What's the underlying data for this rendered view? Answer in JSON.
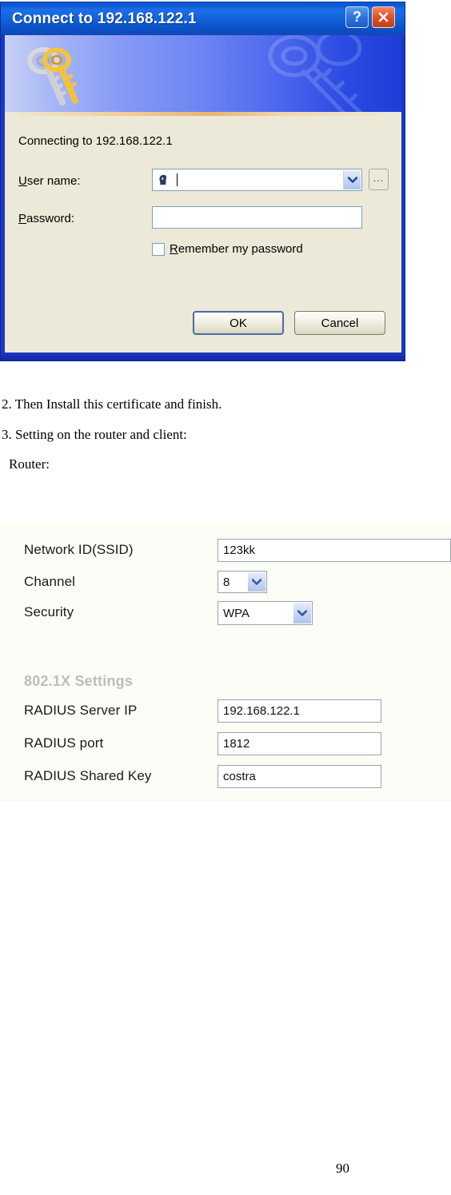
{
  "dialog": {
    "title": "Connect to 192.168.122.1",
    "help_button": "?",
    "close_button": "×",
    "connecting_text": "Connecting to 192.168.122.1",
    "username_label": "User name:",
    "username_value": "",
    "password_label": "Password:",
    "password_value": "",
    "browse_button": "...",
    "remember_label": "Remember my password",
    "remember_checked": false,
    "ok_button": "OK",
    "cancel_button": "Cancel",
    "colors": {
      "titlebar_blue": "#1363de",
      "frame_blue": "#1b37c4",
      "body_beige": "#ece9d8",
      "close_red": "#e2552b"
    }
  },
  "document": {
    "line1": "2. Then Install this certificate and finish.",
    "line2": "3. Setting on the router and client:",
    "line3": "Router:",
    "page_number": "90"
  },
  "router_panel": {
    "rows": [
      {
        "label": "Network ID(SSID)",
        "value": "123kk",
        "type": "text"
      },
      {
        "label": "Channel",
        "value": "8",
        "type": "select"
      },
      {
        "label": "Security",
        "value": "WPA",
        "type": "select"
      }
    ],
    "section_heading": "802.1X Settings",
    "section_heading_color": "#b9c0b9",
    "radius_rows": [
      {
        "label": "RADIUS Server IP",
        "value": "192.168.122.1",
        "type": "text"
      },
      {
        "label": "RADIUS port",
        "value": "1812",
        "type": "text"
      },
      {
        "label": "RADIUS Shared Key",
        "value": "costra",
        "type": "text"
      }
    ]
  }
}
